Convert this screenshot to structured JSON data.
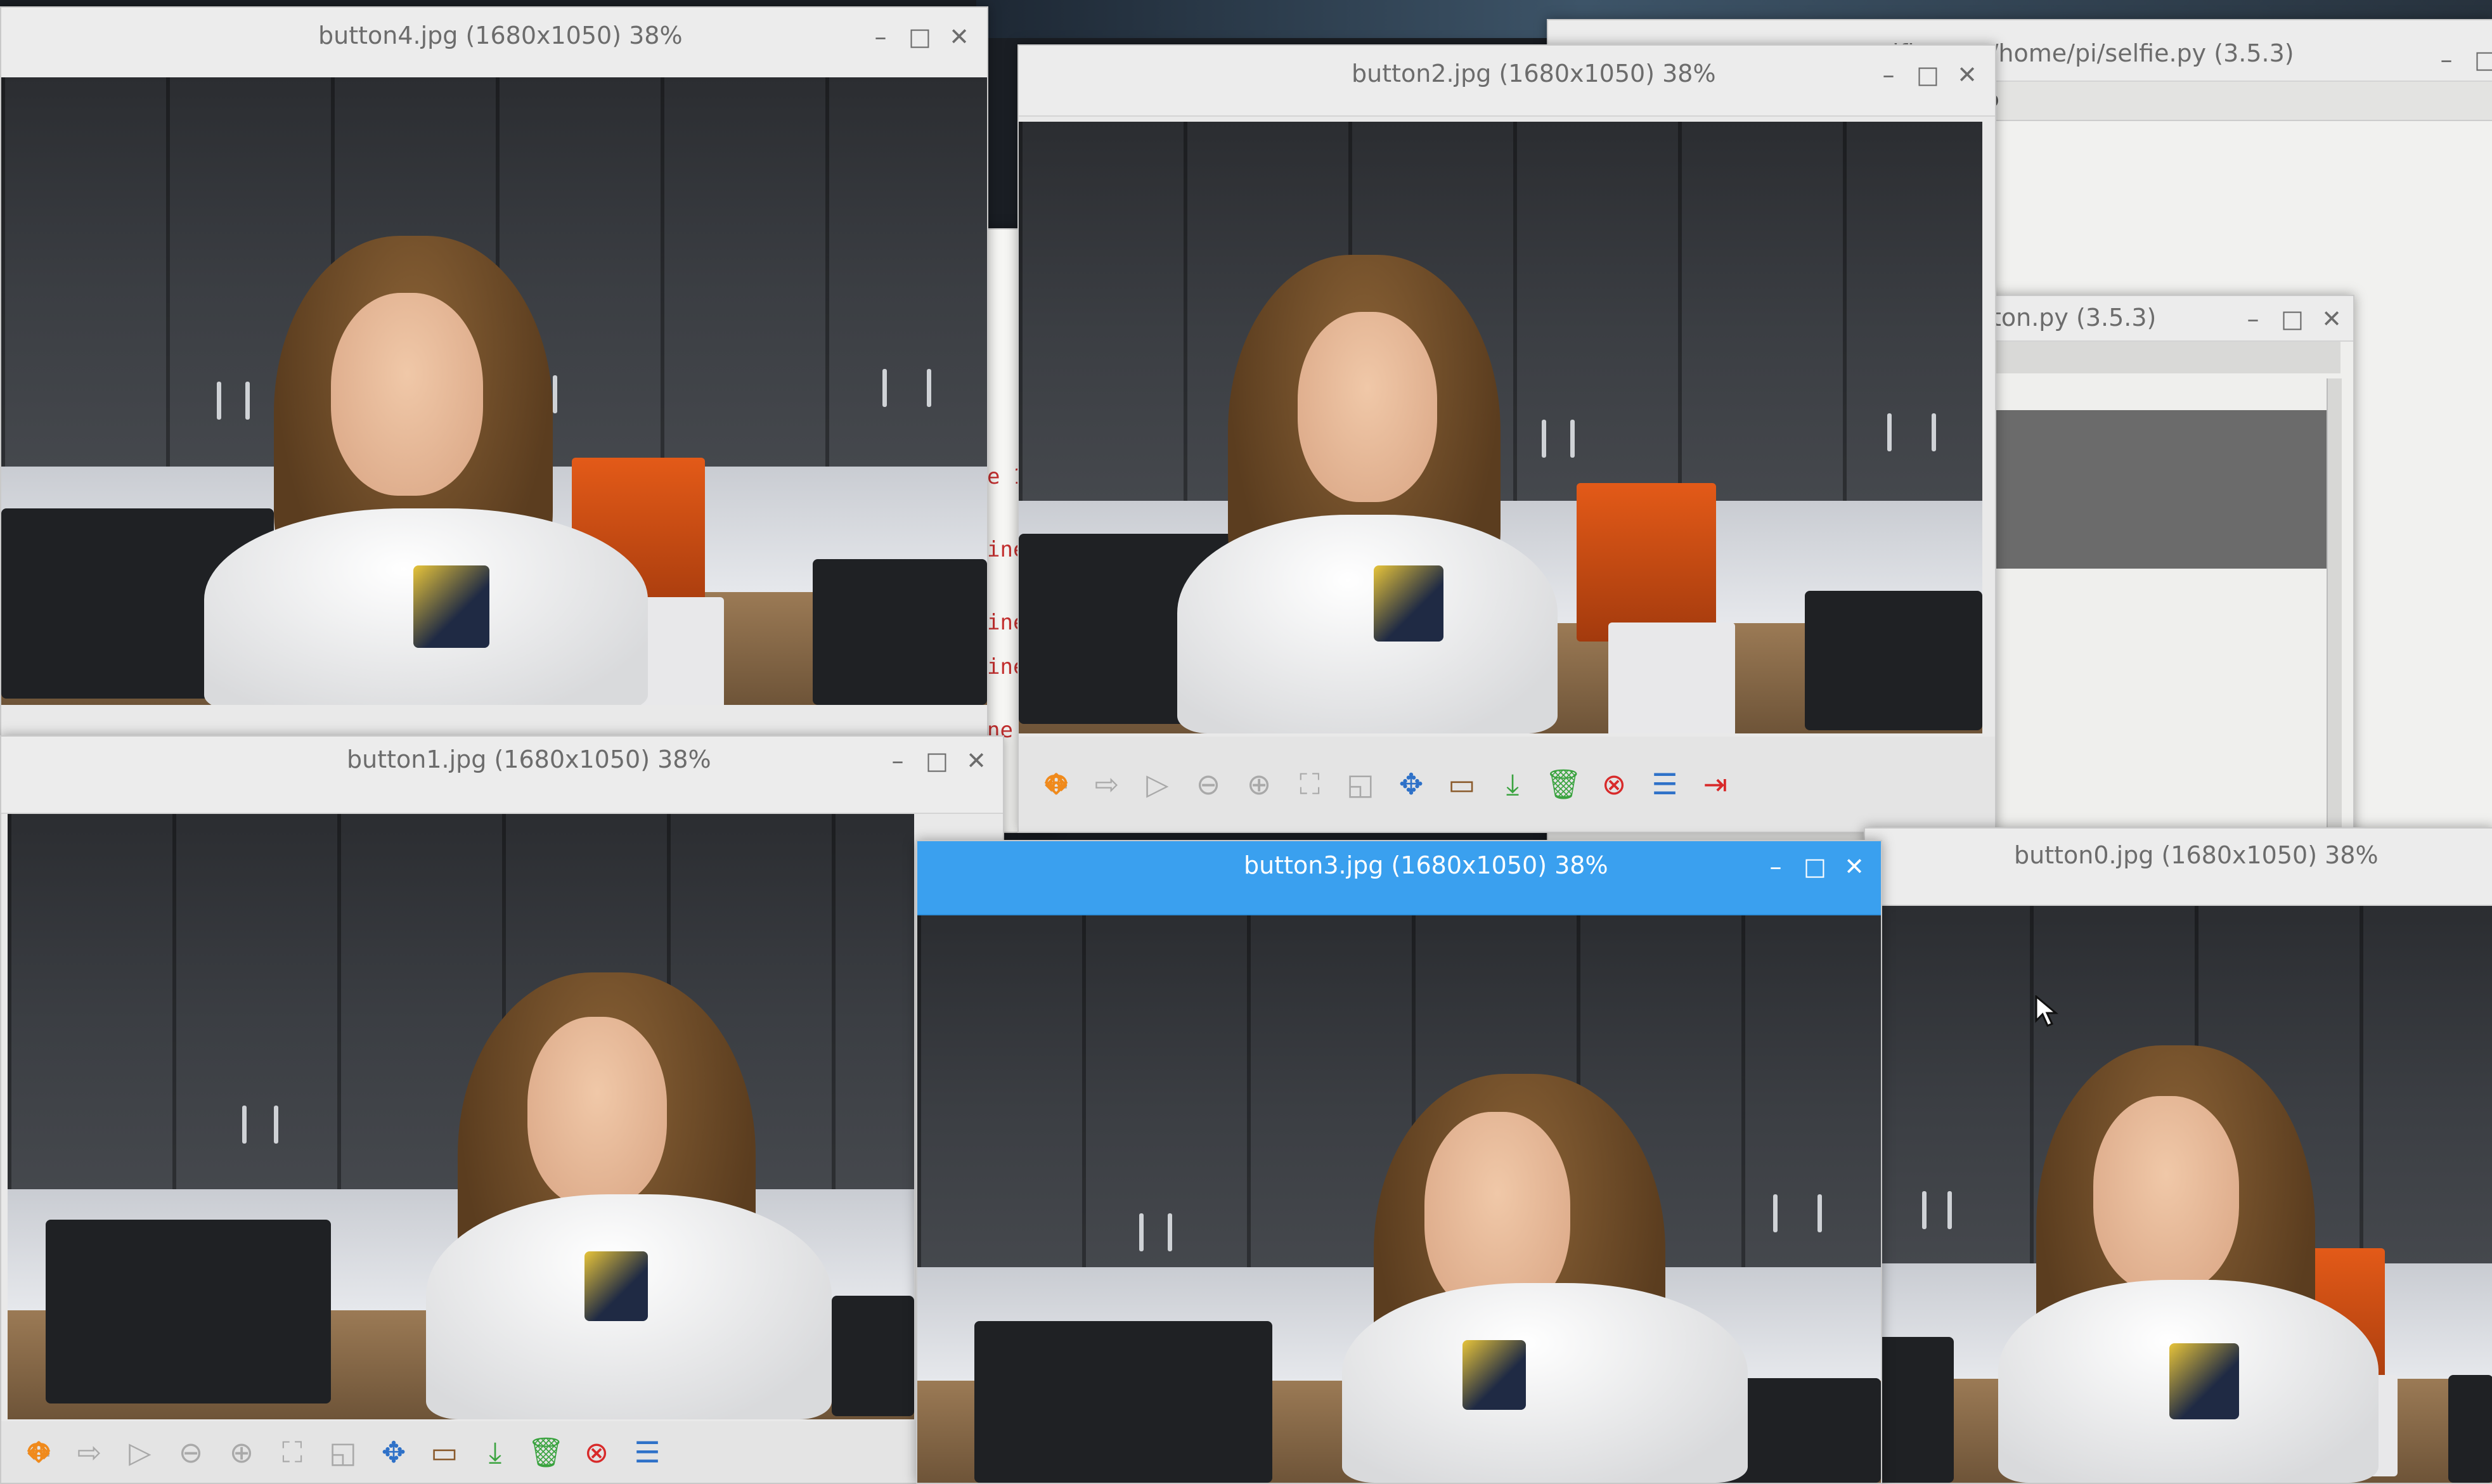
{
  "windows": {
    "selfie_editor": {
      "title": "selfie.py - /home/pi/selfie.py (3.5.3)",
      "menu_fragment": "p"
    },
    "button_editor": {
      "title": "ton.py (3.5.3)"
    },
    "button4": {
      "title": "button4.jpg (1680x1050) 38%"
    },
    "button2": {
      "title": "button2.jpg (1680x1050) 38%"
    },
    "button1": {
      "title": "button1.jpg (1680x1050) 38%"
    },
    "button3": {
      "title": "button3.jpg (1680x1050) 38%"
    },
    "button0": {
      "title": "button0.jpg (1680x1050) 38%"
    }
  },
  "window_controls": {
    "minimize": "–",
    "maximize": "□",
    "close": "✕"
  },
  "code_fragments": [
    "e 1",
    "ine",
    "ine",
    "ine",
    "ne"
  ],
  "toolbar_icons": [
    {
      "name": "previous-icon",
      "glyph": "⇦"
    },
    {
      "name": "next-icon",
      "glyph": "⇨"
    },
    {
      "name": "slideshow-icon",
      "glyph": "▷"
    },
    {
      "name": "zoom-out-icon",
      "glyph": "⊖"
    },
    {
      "name": "zoom-in-icon",
      "glyph": "⊕"
    },
    {
      "name": "fit-icon",
      "glyph": "⛶"
    },
    {
      "name": "original-size-icon",
      "glyph": "◱"
    },
    {
      "name": "fullscreen-icon",
      "glyph": "✥"
    },
    {
      "name": "rotate-left-icon",
      "glyph": "↶"
    },
    {
      "name": "rotate-right-icon",
      "glyph": "↷"
    },
    {
      "name": "flip-horizontal-icon",
      "glyph": "⇔"
    },
    {
      "name": "flip-vertical-icon",
      "glyph": "⇕"
    },
    {
      "name": "open-file-icon",
      "glyph": "▭"
    },
    {
      "name": "save-icon",
      "glyph": "⤓"
    },
    {
      "name": "delete-icon",
      "glyph": "🗑"
    },
    {
      "name": "close-image-icon",
      "glyph": "⊗"
    },
    {
      "name": "preferences-icon",
      "glyph": "☰"
    },
    {
      "name": "exit-icon",
      "glyph": "⇥"
    }
  ],
  "colors": {
    "active_titlebar": "#3aa0ef",
    "inactive_titlebar": "#ececec",
    "code_text": "#c43030"
  }
}
